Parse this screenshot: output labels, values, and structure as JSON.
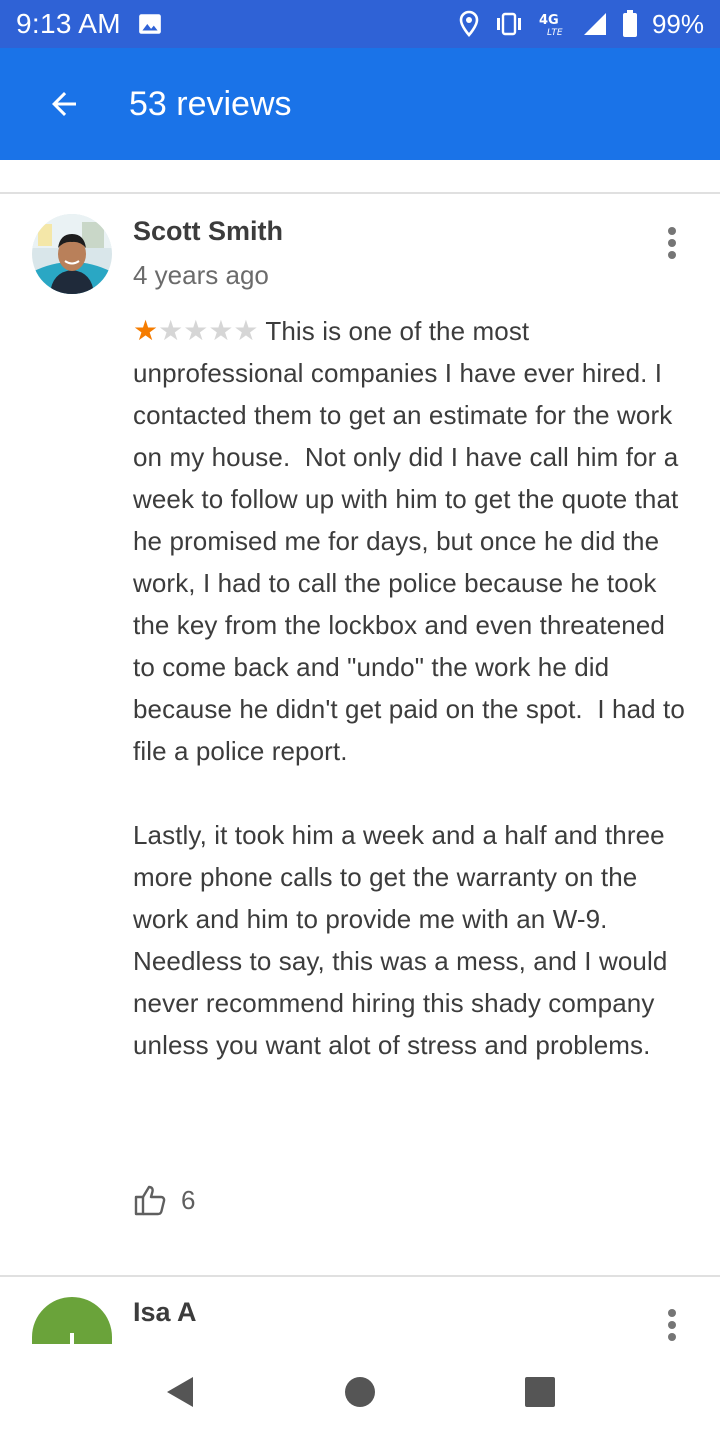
{
  "status_bar": {
    "time": "9:13 AM",
    "network": "4G LTE",
    "battery": "99%"
  },
  "app_bar": {
    "title": "53 reviews",
    "back_icon": "arrow-back-icon"
  },
  "reviews": [
    {
      "author": "Scott Smith",
      "date": "4 years ago",
      "rating": 1,
      "rating_max": 5,
      "text": "This is one of the most unprofessional companies I have ever hired. I contacted them to get an estimate for the work on my house.  Not only did I have call him for a week to follow up with him to get the quote that he promised me for days, but once he did the work, I had to call the police because he took the key from the lockbox and even threatened to come back and \"undo\" the work he did because he didn't get paid on the spot.  I had to file a police report.\n\nLastly, it took him a week and a half and three more phone calls to get the warranty on the work and him to provide me with an W-9.   Needless to say, this was a mess, and I would never recommend hiring this shady company unless you want alot of stress and problems.",
      "likes": "6"
    },
    {
      "author": "Isa A"
    }
  ],
  "colors": {
    "status_bar": "#2f62d6",
    "app_bar": "#1a73e8",
    "star_filled": "#f57c00",
    "star_empty": "#d6d6d6",
    "second_avatar": "#6aa33a"
  }
}
